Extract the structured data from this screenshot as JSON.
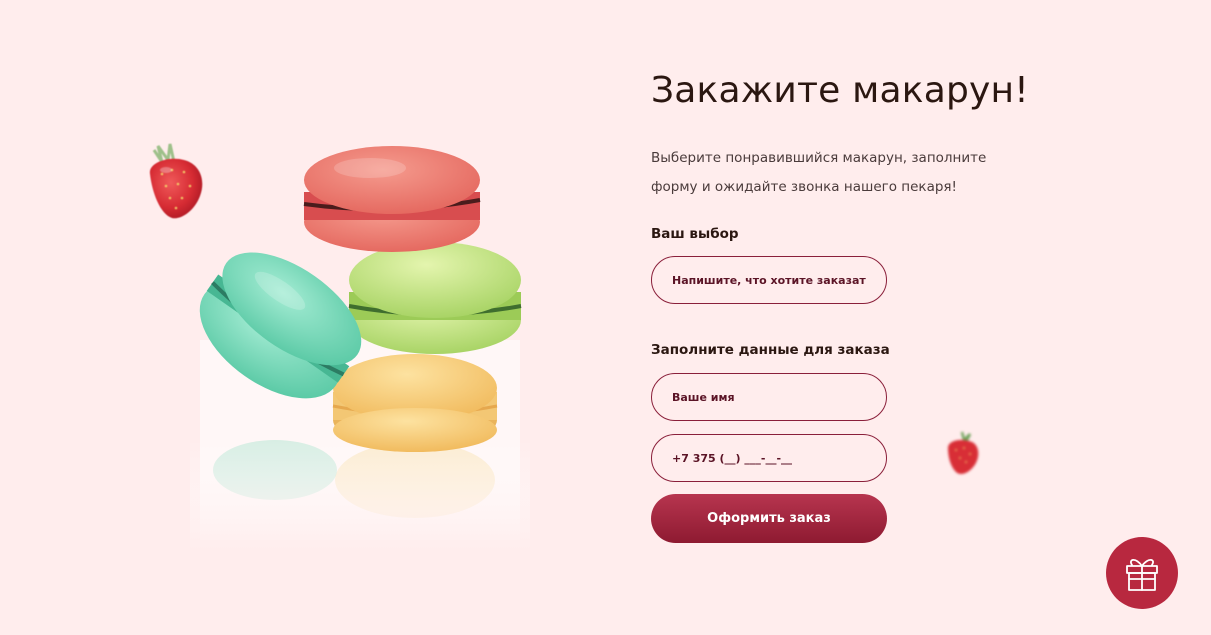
{
  "order": {
    "title": "Закажите макарун!",
    "description": "Выберите понравившийся макарун, заполните форму и ожидайте звонка нашего пекаря!",
    "choice_label": "Ваш выбор",
    "choice_placeholder": "Напишите, что хотите заказать...",
    "details_label": "Заполните данные для заказа",
    "name_placeholder": "Ваше имя",
    "phone_placeholder": "+7 375 (__) ___-__-__",
    "submit_label": "Оформить заказ"
  },
  "decor": {
    "illustration": "macaron-stack",
    "strawberry_icon": "strawberry-icon",
    "gift_icon": "gift-icon"
  },
  "colors": {
    "background": "#ffeded",
    "accent": "#8e1a31",
    "text": "#2b1711"
  }
}
